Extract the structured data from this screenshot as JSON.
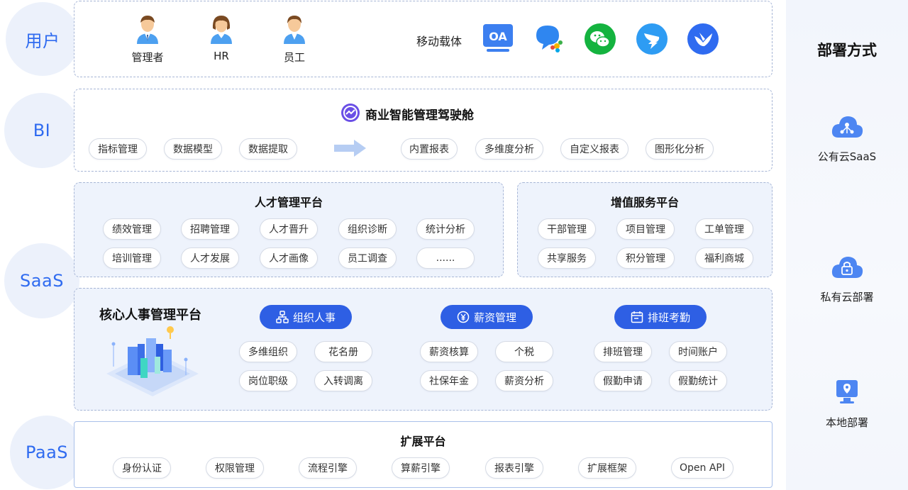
{
  "layers": {
    "user": "用户",
    "bi": "BI",
    "saas": "SaaS",
    "paas": "PaaS"
  },
  "user_layer": {
    "roles": [
      "管理者",
      "HR",
      "员工"
    ],
    "mobile_label": "移动载体",
    "apps": [
      "oa-icon",
      "qq-chat-icon",
      "wechat-icon",
      "dingtalk-icon",
      "feishu-icon"
    ],
    "oa_text": "OA"
  },
  "bi_layer": {
    "title": "商业智能管理驾驶舱",
    "left_items": [
      "指标管理",
      "数据模型",
      "数据提取"
    ],
    "right_items": [
      "内置报表",
      "多维度分析",
      "自定义报表",
      "图形化分析"
    ]
  },
  "talent_platform": {
    "title": "人才管理平台",
    "row1": [
      "绩效管理",
      "招聘管理",
      "人才晋升",
      "组织诊断",
      "统计分析"
    ],
    "row2": [
      "培训管理",
      "人才发展",
      "人才画像",
      "员工调查",
      "......"
    ]
  },
  "value_platform": {
    "title": "增值服务平台",
    "row1": [
      "干部管理",
      "项目管理",
      "工单管理"
    ],
    "row2": [
      "共享服务",
      "积分管理",
      "福利商城"
    ]
  },
  "core_platform": {
    "title": "核心人事管理平台",
    "modules": [
      {
        "name": "组织人事",
        "items": [
          "多维组织",
          "花名册",
          "岗位职级",
          "入转调离"
        ]
      },
      {
        "name": "薪资管理",
        "items": [
          "薪资核算",
          "个税",
          "社保年金",
          "薪资分析"
        ]
      },
      {
        "name": "排班考勤",
        "items": [
          "排班管理",
          "时间账户",
          "假勤申请",
          "假勤统计"
        ]
      }
    ]
  },
  "paas_layer": {
    "title": "扩展平台",
    "items": [
      "身份认证",
      "权限管理",
      "流程引擎",
      "算薪引擎",
      "报表引擎",
      "扩展框架",
      "Open API"
    ]
  },
  "deploy": {
    "title": "部署方式",
    "items": [
      "公有云SaaS",
      "私有云部署",
      "本地部署"
    ]
  },
  "colors": {
    "accent": "#2e5fe4",
    "layer_text": "#2f6bf0",
    "panel_bg": "#eef3fc",
    "dash_border": "#a7b6d6"
  }
}
